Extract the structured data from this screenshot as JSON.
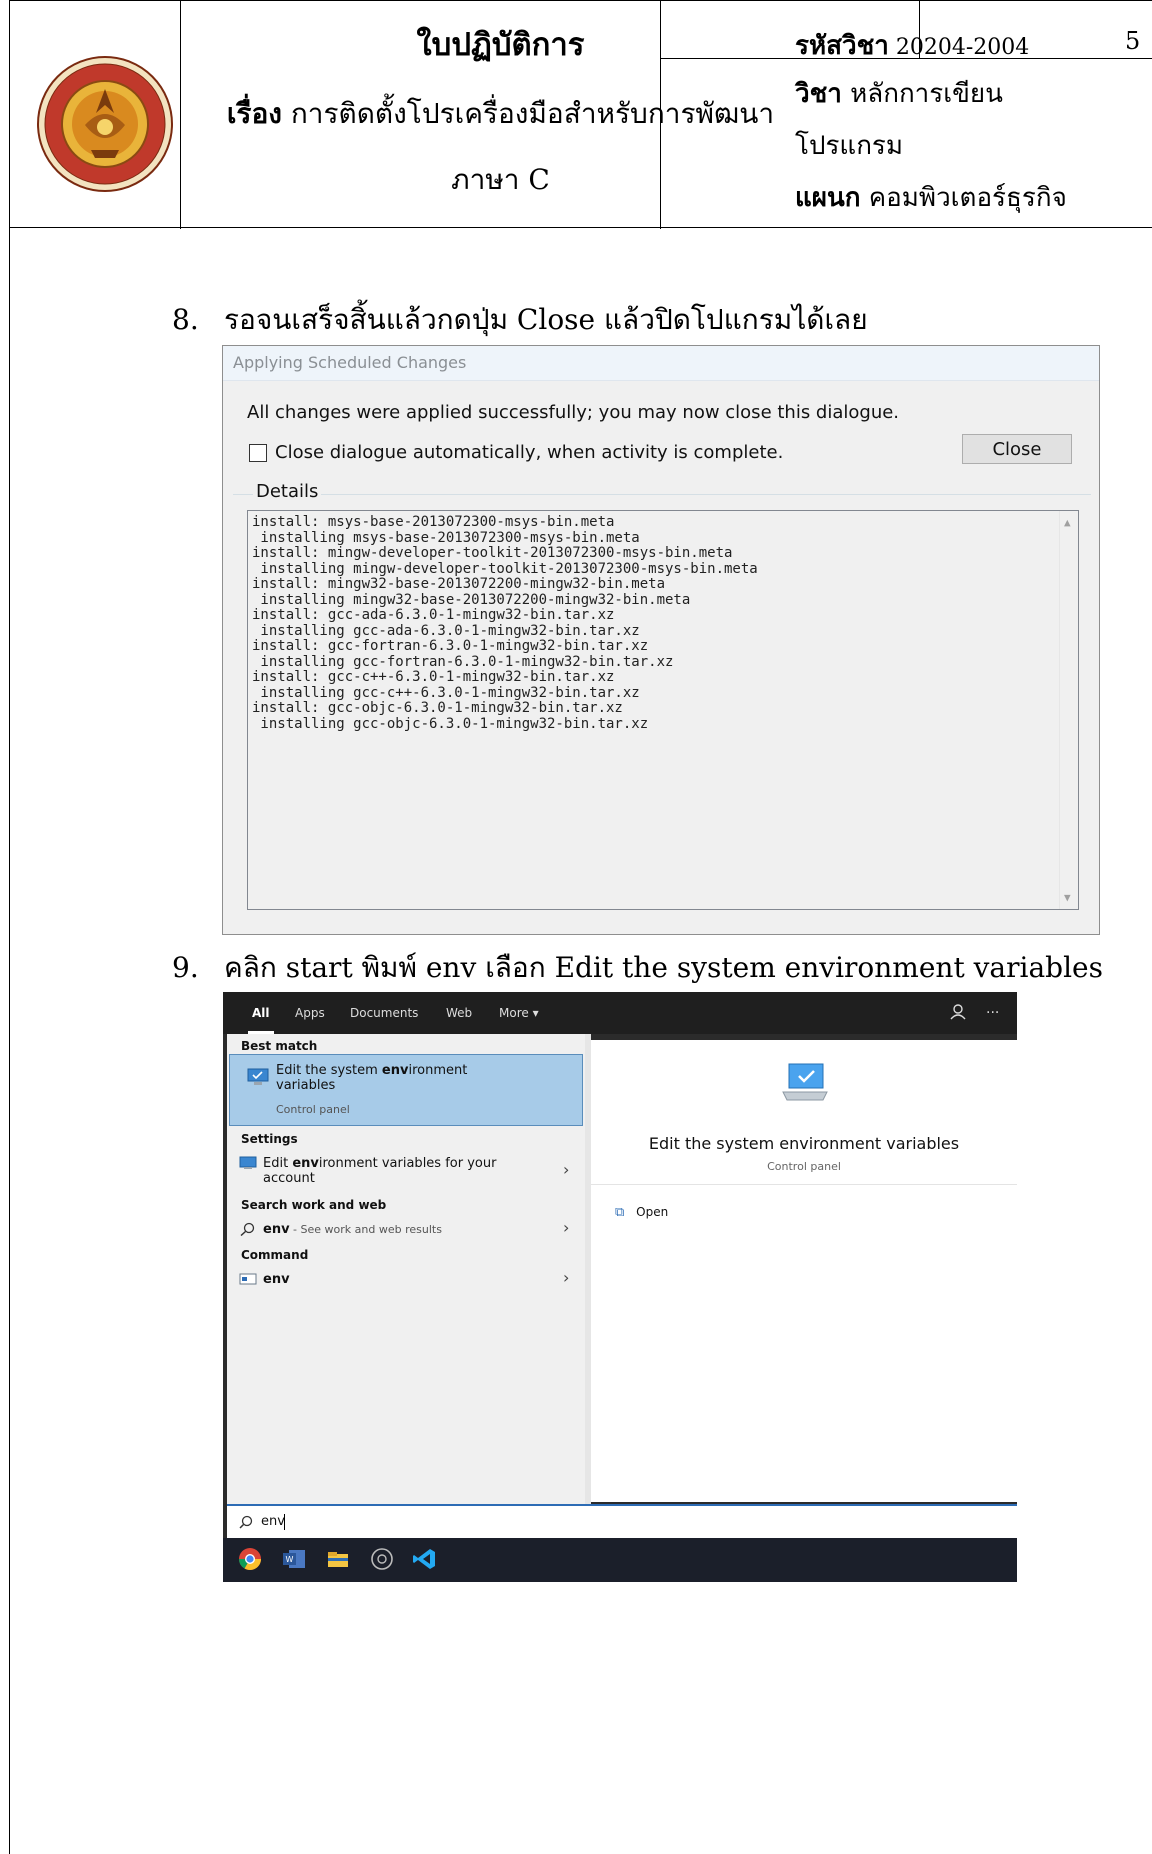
{
  "header": {
    "sheet_title": "ใบปฏิบัติการ",
    "subject_label": "เรื่อง",
    "subject_line1": "การติดตั้งโปรเครื่องมือสำหรับการพัฒนา",
    "subject_line2": "ภาษา C",
    "code_label": "รหัสวิชา",
    "code_value": "20204-2004",
    "page_number": "5",
    "course_label": "วิชา",
    "course_line1": "หลักการเขียน",
    "course_line2": "โปรแกรม",
    "dept_label": "แผนก",
    "dept_value": "คอมพิวเตอร์ธุรกิจ"
  },
  "steps": [
    {
      "num": "8.",
      "text": "รอจนเสร็จสิ้นแล้วกดปุ่ม Close แล้วปิดโปแกรมได้เลย"
    },
    {
      "num": "9.",
      "text": "คลิก start พิมพ์ env เลือก Edit the system environment variables"
    }
  ],
  "dialog": {
    "title": "Applying Scheduled Changes",
    "message": "All changes were applied successfully; you may now close this dialogue.",
    "checkbox_label": "Close dialogue automatically, when activity is complete.",
    "close_button": "Close",
    "details_label": "Details",
    "log": [
      "install: msys-base-2013072300-msys-bin.meta",
      " installing msys-base-2013072300-msys-bin.meta",
      "install: mingw-developer-toolkit-2013072300-msys-bin.meta",
      " installing mingw-developer-toolkit-2013072300-msys-bin.meta",
      "install: mingw32-base-2013072200-mingw32-bin.meta",
      " installing mingw32-base-2013072200-mingw32-bin.meta",
      "install: gcc-ada-6.3.0-1-mingw32-bin.tar.xz",
      " installing gcc-ada-6.3.0-1-mingw32-bin.tar.xz",
      "install: gcc-fortran-6.3.0-1-mingw32-bin.tar.xz",
      " installing gcc-fortran-6.3.0-1-mingw32-bin.tar.xz",
      "install: gcc-c++-6.3.0-1-mingw32-bin.tar.xz",
      " installing gcc-c++-6.3.0-1-mingw32-bin.tar.xz",
      "install: gcc-objc-6.3.0-1-mingw32-bin.tar.xz",
      " installing gcc-objc-6.3.0-1-mingw32-bin.tar.xz"
    ]
  },
  "search": {
    "tabs": [
      "All",
      "Apps",
      "Documents",
      "Web",
      "More ▾"
    ],
    "best_match_heading": "Best match",
    "best_match_title_1": "Edit the system ",
    "best_match_title_bold": "env",
    "best_match_title_2": "ironment",
    "best_match_title_3": "variables",
    "best_match_sub": "Control panel",
    "settings_heading": "Settings",
    "settings_item_1": "Edit ",
    "settings_item_bold": "env",
    "settings_item_2": "ironment variables for your",
    "settings_item_3": "account",
    "web_heading": "Search work and web",
    "web_item_bold": "env",
    "web_item_rest": " - See work and web results",
    "command_heading": "Command",
    "command_item": "env",
    "right_title": "Edit the system environment variables",
    "right_sub": "Control panel",
    "open_label": "Open",
    "query": "env"
  }
}
